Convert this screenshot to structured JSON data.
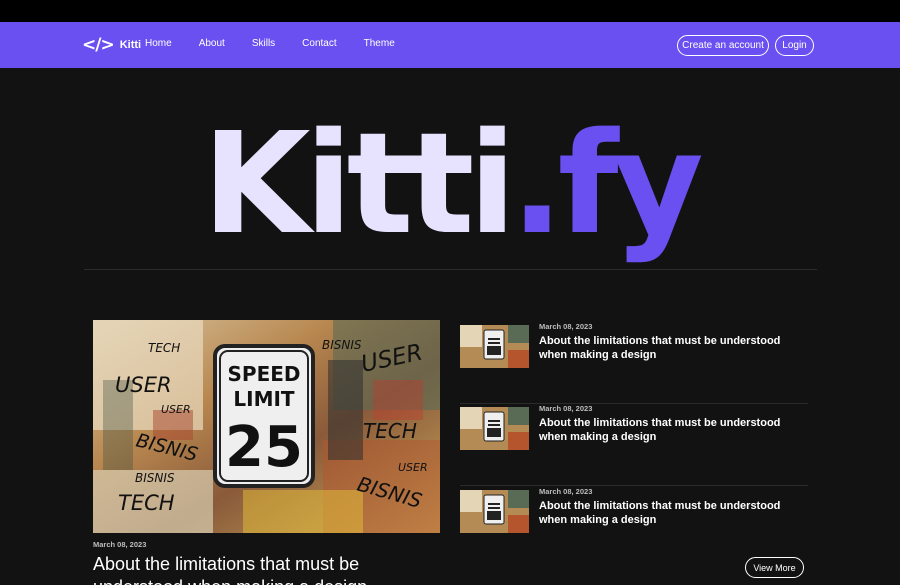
{
  "nav": {
    "brand_logo": "</>",
    "brand_name": "Kitti",
    "links": [
      "Home",
      "About",
      "Skills",
      "Contact",
      "Theme"
    ],
    "create_account": "Create an account",
    "login": "Login",
    "bg_color": "#6a50f0"
  },
  "hero": {
    "title_main": "Kitti",
    "title_accent": ".fy",
    "accent_color": "#6a50f0"
  },
  "featured": {
    "image_sign": [
      "SPEED",
      "LIMIT",
      "25"
    ],
    "image_words": [
      "USER",
      "TECH",
      "BISNIS",
      "USER",
      "BISNIS",
      "TECH",
      "USER",
      "BISNIS",
      "USER",
      "TECH"
    ],
    "date": "March 08, 2023",
    "title": "About the limitations that must be understood when making a design"
  },
  "posts": [
    {
      "date": "March 08, 2023",
      "title": "About the limitations that must be understood when making a design"
    },
    {
      "date": "March 08, 2023",
      "title": "About the limitations that must be understood when making a design"
    },
    {
      "date": "March 08, 2023",
      "title": "About the limitations that must be understood when making a design"
    }
  ],
  "view_more": "View More"
}
